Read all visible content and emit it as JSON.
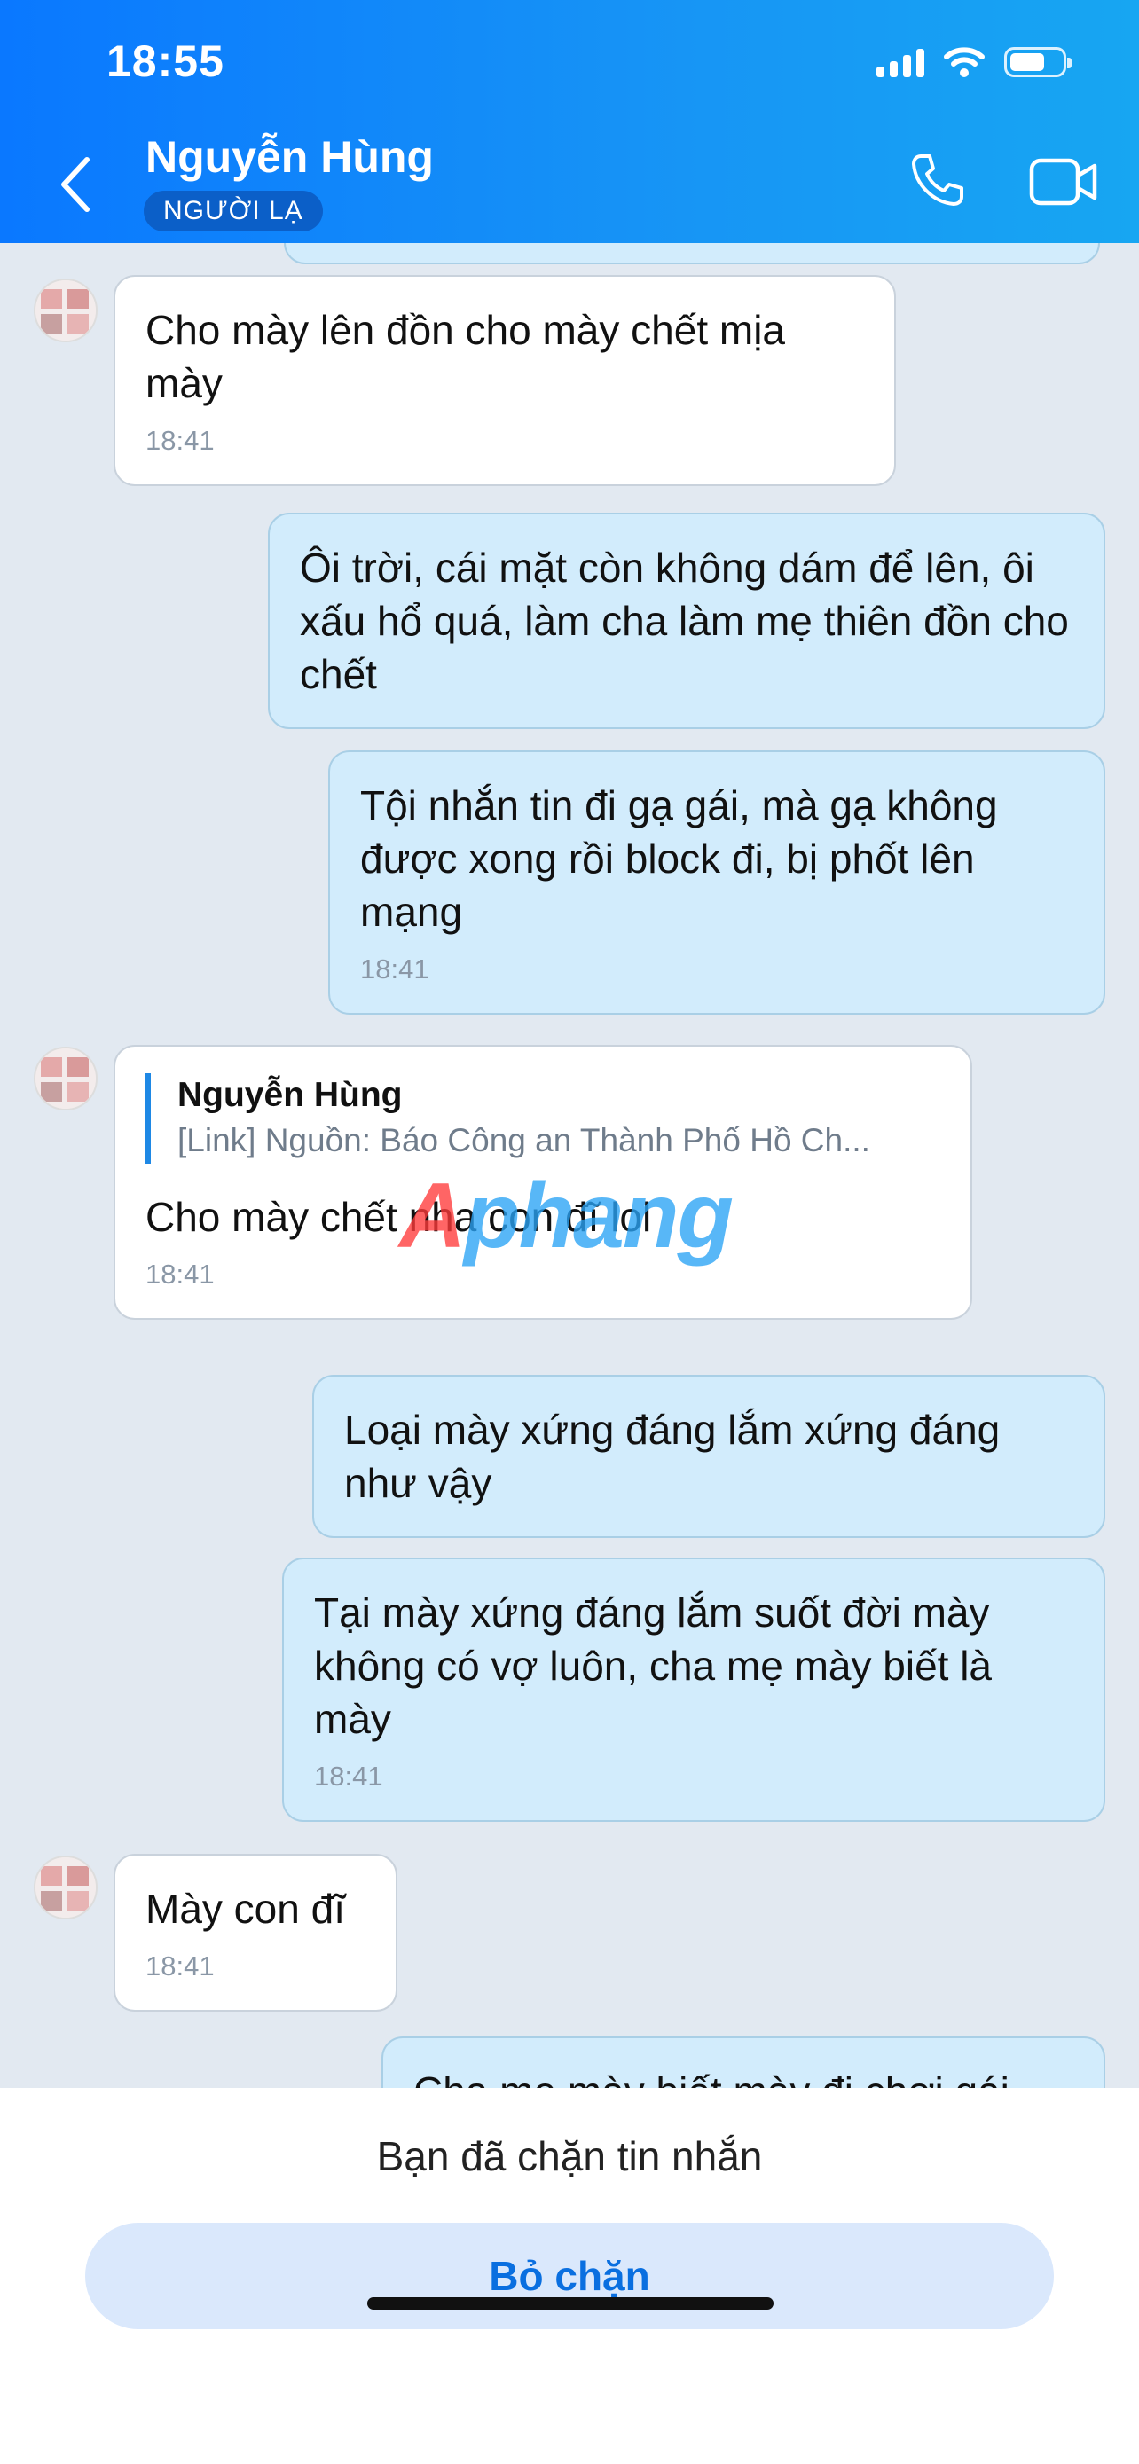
{
  "status_bar": {
    "time": "18:55"
  },
  "header": {
    "contact_name": "Nguyễn Hùng",
    "badge": "NGƯỜI LẠ"
  },
  "messages": [
    {
      "text": "Cho mày lên đồn cho mày chết mịa mày",
      "time": "18:41"
    },
    {
      "text": "Ôi trời, cái mặt còn không dám để lên, ôi xấu hổ quá, làm cha làm mẹ thiên đồn cho chết"
    },
    {
      "text": "Tội nhắn tin đi gạ gái, mà gạ không được xong rồi block đi, bị phốt lên mạng",
      "time": "18:41"
    },
    {
      "quote_name": "Nguyễn Hùng",
      "quote_text": "[Link] Nguồn: Báo Công an Thành Phố Hồ Ch...",
      "text": "Cho mày chết nha con đĩ lol",
      "time": "18:41"
    },
    {
      "text": "Loại mày xứng đáng lắm xứng đáng như vậy"
    },
    {
      "text": "Tại mày xứng đáng lắm suốt đời mày không có vợ luôn, cha mẹ mày biết là mày",
      "time": "18:41"
    },
    {
      "text": "Mày con đĩ",
      "time": "18:41"
    },
    {
      "text": "Cha mẹ mày biết mày đi chơi gái"
    }
  ],
  "watermark": {
    "part1": "Ap",
    "part2": "hang"
  },
  "footer": {
    "blocked_text": "Bạn đã chặn tin nhắn",
    "unblock_label": "Bỏ chặn"
  },
  "colors": {
    "header": "#0a78ff",
    "sent_bubble": "#d2ecfc",
    "received_bubble": "#ffffff",
    "accent": "#0a6fe0"
  }
}
